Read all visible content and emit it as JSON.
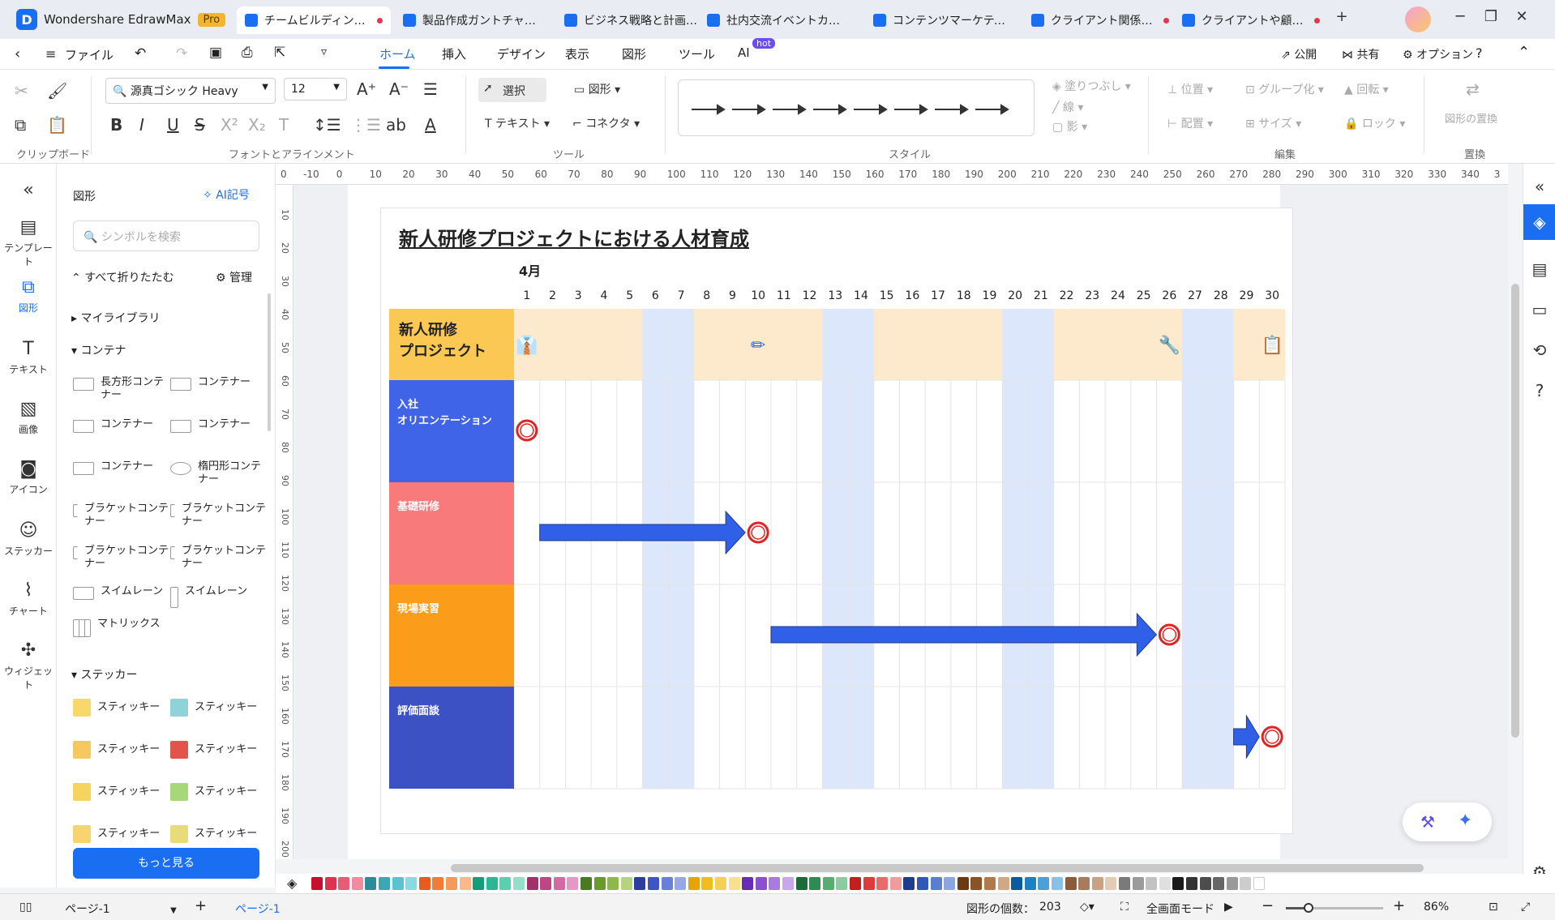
{
  "app": {
    "name": "Wondershare EdrawMax",
    "badge": "Pro"
  },
  "tabs": [
    {
      "label": "チームビルディングと…",
      "active": true,
      "dot": true
    },
    {
      "label": "製品作成ガントチャート",
      "active": false,
      "dot": false
    },
    {
      "label": "ビジネス戦略と計画の…",
      "active": false,
      "dot": false
    },
    {
      "label": "社内交流イベントカレ…",
      "active": false,
      "dot": false
    },
    {
      "label": "コンテンツマーケティング…",
      "active": false,
      "dot": false
    },
    {
      "label": "クライアント関係管…",
      "active": false,
      "dot": true
    },
    {
      "label": "クライアントや顧客…",
      "active": false,
      "dot": true
    }
  ],
  "menu": {
    "file": "ファイル",
    "items": [
      "ホーム",
      "挿入",
      "デザイン",
      "表示",
      "図形",
      "ツール",
      "AI"
    ],
    "hot": "hot",
    "publish": "公開",
    "share": "共有",
    "options": "オプション"
  },
  "ribbon": {
    "font_name": "源真ゴシック Heavy",
    "font_size": "12",
    "select": "選択",
    "shape": "図形",
    "text": "テキスト",
    "connector": "コネクタ",
    "fill": "塗りつぶし",
    "line": "線",
    "shadow": "影",
    "position": "位置",
    "group": "グループ化",
    "rotate": "回転",
    "align": "配置",
    "size": "サイズ",
    "lock": "ロック",
    "replace": "図形の置換",
    "groups": {
      "clipboard": "クリップボード",
      "font": "フォントとアラインメント",
      "tools": "ツール",
      "style": "スタイル",
      "edit": "編集",
      "replace": "置換"
    }
  },
  "rail": [
    {
      "label": "テンプレート",
      "icon": "template-icon"
    },
    {
      "label": "図形",
      "icon": "shapes-icon",
      "active": true
    },
    {
      "label": "テキスト",
      "icon": "text-icon"
    },
    {
      "label": "画像",
      "icon": "image-icon"
    },
    {
      "label": "アイコン",
      "icon": "icon-icon"
    },
    {
      "label": "ステッカー",
      "icon": "sticker-icon"
    },
    {
      "label": "チャート",
      "icon": "chart-icon"
    },
    {
      "label": "ウィジェット",
      "icon": "widget-icon"
    }
  ],
  "panel": {
    "title": "図形",
    "ai_symbol": "AI記号",
    "search_placeholder": "シンボルを検索",
    "collapse_all": "すべて折りたたむ",
    "manage": "管理",
    "my_library": "マイライブラリ",
    "container": "コンテナ",
    "container_items": [
      "長方形コンテナー",
      "コンテナー",
      "コンテナー",
      "コンテナー",
      "コンテナー",
      "楕円形コンテナー",
      "ブラケットコンテナー",
      "ブラケットコンテナー",
      "ブラケットコンテナー",
      "ブラケットコンテナー",
      "スイムレーン",
      "スイムレーン",
      "マトリックス"
    ],
    "sticker": "ステッカー",
    "sticker_items": [
      "スティッキー",
      "スティッキー",
      "スティッキー",
      "スティッキー",
      "スティッキー",
      "スティッキー",
      "スティッキー",
      "スティッキー"
    ],
    "more": "もっと見る"
  },
  "ruler": {
    "top": [
      "0",
      "-10",
      "0",
      "10",
      "20",
      "30",
      "40",
      "50",
      "60",
      "70",
      "80",
      "90",
      "100",
      "110",
      "120",
      "130",
      "140",
      "150",
      "160",
      "170",
      "180",
      "190",
      "200",
      "210",
      "220",
      "230",
      "240",
      "250",
      "260",
      "270",
      "280",
      "290",
      "300",
      "310",
      "320",
      "330",
      "340",
      "3"
    ],
    "left": [
      "10",
      "20",
      "30",
      "40",
      "50",
      "60",
      "70",
      "80",
      "90",
      "100",
      "110",
      "120",
      "130",
      "140",
      "150",
      "160",
      "170",
      "180",
      "190",
      "200"
    ]
  },
  "gantt": {
    "title": "新人研修プロジェクトにおける人材育成",
    "month": "4月",
    "days": [
      "1",
      "2",
      "3",
      "4",
      "5",
      "6",
      "7",
      "8",
      "9",
      "10",
      "11",
      "12",
      "13",
      "14",
      "15",
      "16",
      "17",
      "18",
      "19",
      "20",
      "21",
      "22",
      "23",
      "24",
      "25",
      "26",
      "27",
      "28",
      "29",
      "30"
    ],
    "weekend_days": [
      6,
      7,
      13,
      14,
      20,
      21,
      27,
      28
    ],
    "header": {
      "label_line1": "新人研修",
      "label_line2": "プロジェクト",
      "icons": [
        {
          "day": 1,
          "icon": "necktie-icon"
        },
        {
          "day": 10,
          "icon": "pencil-icon"
        },
        {
          "day": 26,
          "icon": "tools-icon"
        },
        {
          "day": 30,
          "icon": "clipboard-check-icon"
        }
      ]
    },
    "rows": [
      {
        "label_line1": "入社",
        "label_line2": "オリエンテーション",
        "color": "#3f64e8",
        "start": 1,
        "end": 1
      },
      {
        "label_line1": "基礎研修",
        "label_line2": "",
        "color": "#f97a7a",
        "start": 2,
        "end": 10
      },
      {
        "label_line1": "現場実習",
        "label_line2": "",
        "color": "#fb9c1a",
        "start": 11,
        "end": 26
      },
      {
        "label_line1": "評価面談",
        "label_line2": "",
        "color": "#3c52c4",
        "start": 29,
        "end": 30
      }
    ],
    "colors": {
      "header_bg": "#fde9cc",
      "header_label": "#fbc953",
      "weekend": "#dde7fb",
      "arrow": "#3060e8",
      "milestone": "#e02424"
    }
  },
  "status": {
    "page_selector": "ページ-1",
    "page_tab": "ページ-1",
    "shape_count_label": "図形の個数：",
    "shape_count": "203",
    "fullscreen": "全画面モード",
    "zoom": "86%"
  },
  "palette": [
    "#c8102e",
    "#e0334f",
    "#e85b72",
    "#f28aa0",
    "#2b8c9a",
    "#3aa7b5",
    "#5bc3d0",
    "#8bd9e2",
    "#e85d1e",
    "#f27c36",
    "#f69a5c",
    "#f9b988",
    "#169c7a",
    "#2bb793",
    "#5ccfad",
    "#93e0c8",
    "#a32f6b",
    "#c04486",
    "#d46aa3",
    "#e598c1",
    "#4a7a1e",
    "#6a9a2b",
    "#8fb84a",
    "#b5d47f",
    "#2c3e9e",
    "#3f55c4",
    "#6a7fd8",
    "#98a7e6",
    "#e6a400",
    "#f2bc1f",
    "#f6cf55",
    "#fae08c",
    "#6a2bb5",
    "#8b4fcf",
    "#a97bdc",
    "#c9a8ea",
    "#1b6b3a",
    "#2e8c50",
    "#56ad72",
    "#8ccb9f",
    "#c41f1f",
    "#e03a3a",
    "#e86a6a",
    "#f29b9b",
    "#1e3d8c",
    "#2f58b8",
    "#5a7fcf",
    "#8ea6e0",
    "#6b3a13",
    "#8c5224",
    "#b07a4d",
    "#d0a882",
    "#0b5c9e",
    "#1d7fc4",
    "#4d9fd6",
    "#88c0e6",
    "#8a5c3c",
    "#a97b5a",
    "#c9a285",
    "#e3cbb6",
    "#7a7a7a",
    "#9b9b9b",
    "#c2c2c2",
    "#e0e0e0",
    "#1a1a1a",
    "#333333",
    "#4d4d4d",
    "#666666",
    "#999999",
    "#cccccc",
    "#ffffff"
  ]
}
